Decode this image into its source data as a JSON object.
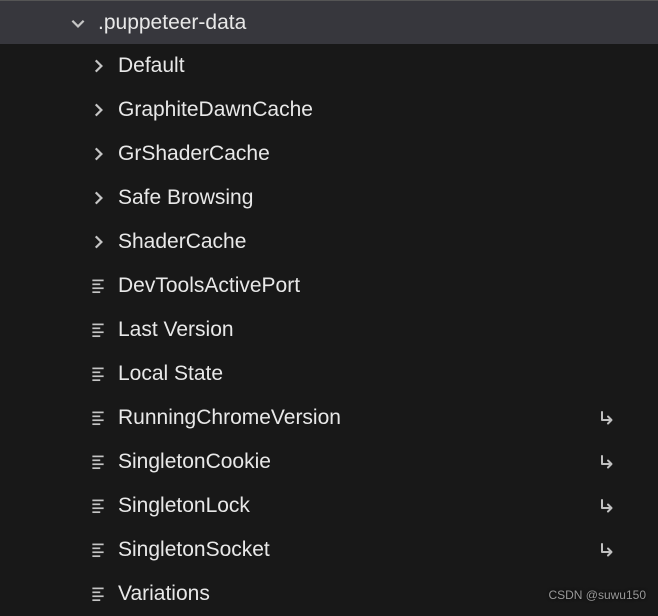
{
  "root": {
    "label": ".puppeteer-data",
    "expanded": true
  },
  "children": [
    {
      "label": "Default",
      "type": "folder",
      "expanded": false,
      "symlink": false
    },
    {
      "label": "GraphiteDawnCache",
      "type": "folder",
      "expanded": false,
      "symlink": false
    },
    {
      "label": "GrShaderCache",
      "type": "folder",
      "expanded": false,
      "symlink": false
    },
    {
      "label": "Safe Browsing",
      "type": "folder",
      "expanded": false,
      "symlink": false
    },
    {
      "label": "ShaderCache",
      "type": "folder",
      "expanded": false,
      "symlink": false
    },
    {
      "label": "DevToolsActivePort",
      "type": "file",
      "expanded": false,
      "symlink": false
    },
    {
      "label": "Last Version",
      "type": "file",
      "expanded": false,
      "symlink": false
    },
    {
      "label": "Local State",
      "type": "file",
      "expanded": false,
      "symlink": false
    },
    {
      "label": "RunningChromeVersion",
      "type": "file",
      "expanded": false,
      "symlink": true
    },
    {
      "label": "SingletonCookie",
      "type": "file",
      "expanded": false,
      "symlink": true
    },
    {
      "label": "SingletonLock",
      "type": "file",
      "expanded": false,
      "symlink": true
    },
    {
      "label": "SingletonSocket",
      "type": "file",
      "expanded": false,
      "symlink": true
    },
    {
      "label": "Variations",
      "type": "file",
      "expanded": false,
      "symlink": false
    }
  ],
  "watermark": "CSDN @suwu150"
}
